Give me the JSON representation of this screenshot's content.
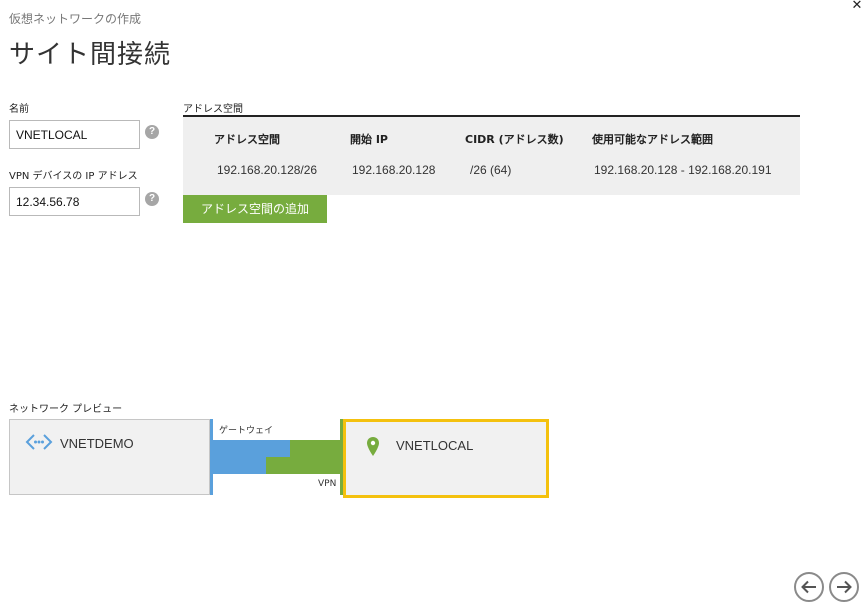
{
  "dialog": {
    "subtitle": "仮想ネットワークの作成",
    "title": "サイト間接続"
  },
  "form": {
    "name_label": "名前",
    "name_value": "VNETLOCAL",
    "vpn_ip_label": "VPN デバイスの IP アドレス",
    "vpn_ip_value": "12.34.56.78",
    "help_glyph": "?"
  },
  "address_space": {
    "section_label": "アドレス空間",
    "columns": [
      "アドレス空間",
      "開始 IP",
      "CIDR (アドレス数)",
      "使用可能なアドレス範囲"
    ],
    "rows": [
      [
        "192.168.20.128/26",
        "192.168.20.128",
        "/26 (64)",
        "192.168.20.128 - 192.168.20.191"
      ]
    ],
    "add_button_label": "アドレス空間の追加"
  },
  "preview": {
    "section_label": "ネットワーク プレビュー",
    "vnet_name": "VNETDEMO",
    "gateway_label": "ゲートウェイ",
    "vpn_label": "VPN",
    "local_name": "VNETLOCAL"
  },
  "colors": {
    "accent_green": "#77ac3e",
    "accent_blue": "#5aa0dc",
    "selection_yellow": "#f4c10e"
  },
  "icons": {
    "close": "close-icon",
    "vnet": "virtual-network-icon",
    "local": "location-pin-icon",
    "back": "arrow-left-icon",
    "next": "arrow-right-icon"
  }
}
